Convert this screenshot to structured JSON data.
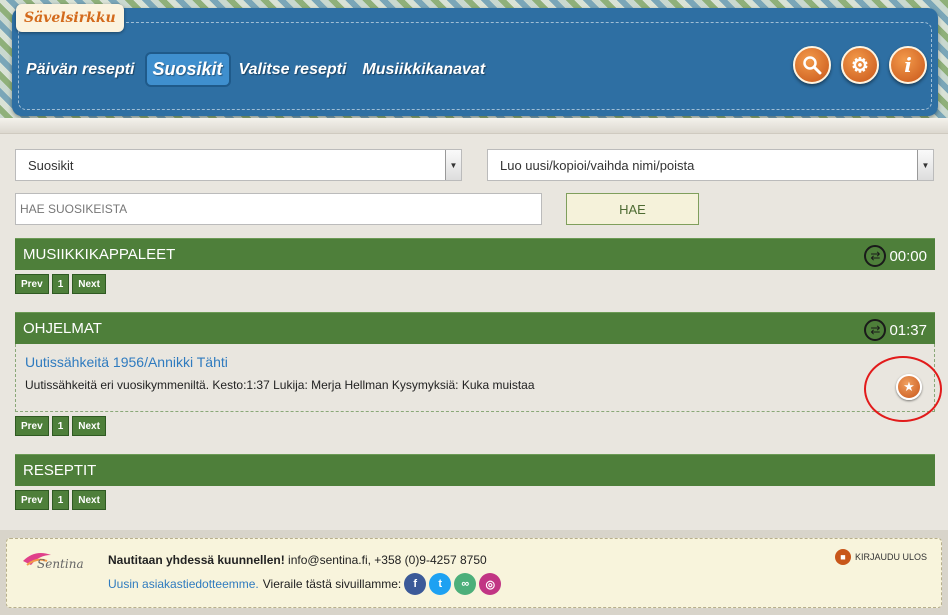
{
  "app": {
    "logo": "Sävelsirkku"
  },
  "nav": {
    "items": [
      "Päivän resepti",
      "Suosikit",
      "Valitse resepti",
      "Musiikkikanavat"
    ],
    "active": "Suosikit"
  },
  "header_buttons": {
    "search": "search-icon",
    "settings": "gear-icon",
    "info": "info-icon"
  },
  "filters": {
    "list_select": "Suosikit",
    "action_select": "Luo uusi/kopioi/vaihda nimi/poista",
    "search_placeholder": "HAE SUOSIKEISTA",
    "search_button": "HAE"
  },
  "sections": {
    "music": {
      "title": "MUSIIKKIKAPPALEET",
      "time": "00:00"
    },
    "programs": {
      "title": "OHJELMAT",
      "time": "01:37"
    },
    "recipes": {
      "title": "RESEPTIT"
    }
  },
  "pager": {
    "prev": "Prev",
    "page": "1",
    "next": "Next"
  },
  "program": {
    "title": "Uutissähkeitä 1956/Annikki Tähti",
    "description": "Uutissähkeitä eri vuosikymmeniltä. Kesto:1:37 Lukija: Merja Hellman Kysymyksiä: Kuka muistaa"
  },
  "footer": {
    "brand": "Sentina",
    "bold_text": "Nautitaan yhdessä kuunnellen!",
    "contact": " info@sentina.fi, +358 (0)9-4257 8750",
    "link_text": "Uusin asiakastiedotteemme.",
    "visit_text": "Vieraile tästä sivuillamme:",
    "logout": "KIRJAUDU ULOS"
  },
  "colors": {
    "header_blue": "#2e6fa3",
    "section_green": "#4e7f3a",
    "accent_orange": "#c8561a",
    "link_blue": "#2f7bbf"
  }
}
